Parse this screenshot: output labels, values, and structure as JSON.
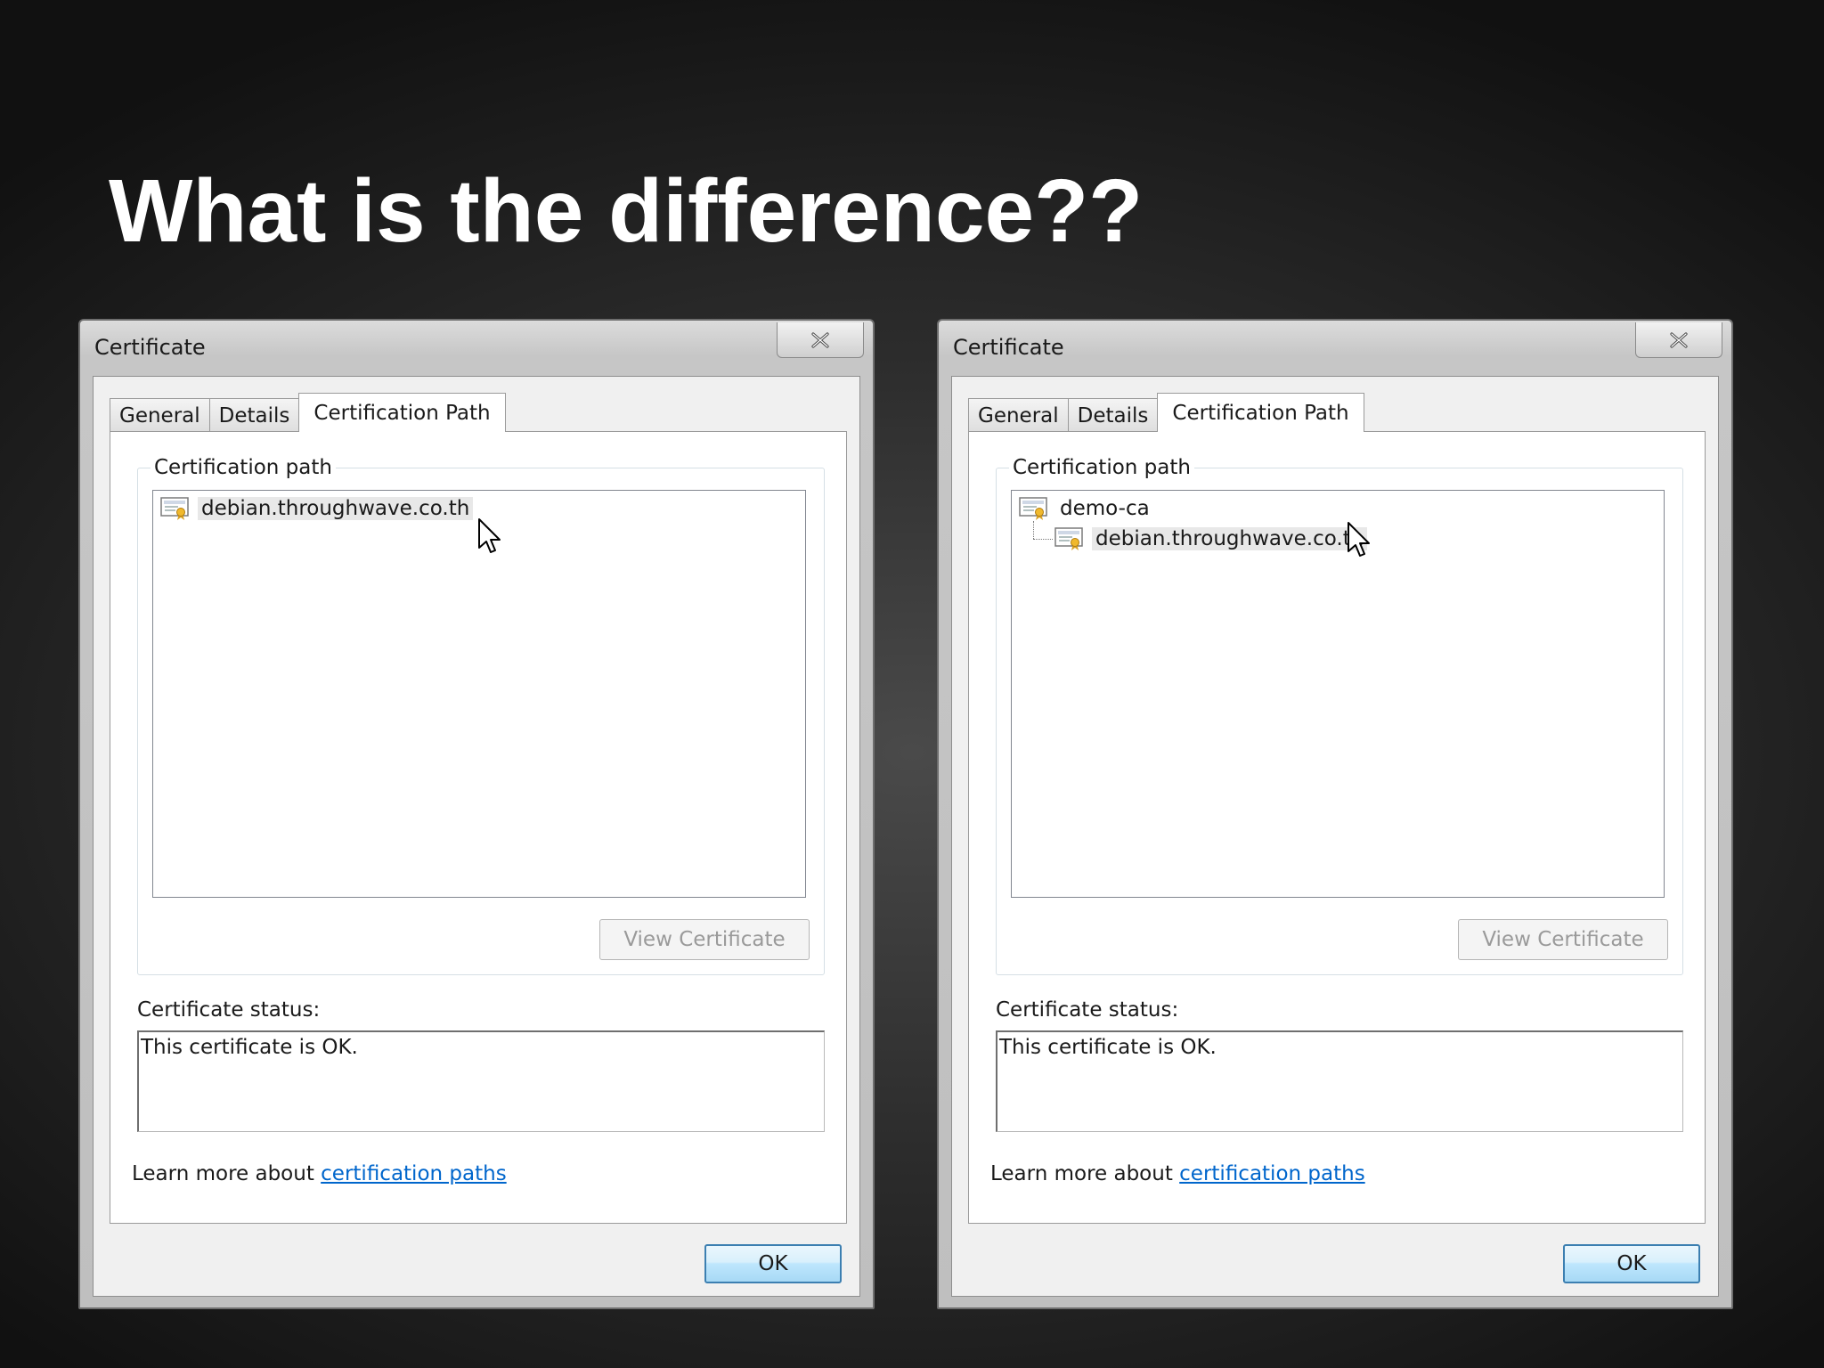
{
  "slide": {
    "title": "What is the difference??"
  },
  "dialogs": [
    {
      "title": "Certificate",
      "tabs": [
        "General",
        "Details",
        "Certification Path"
      ],
      "active_tab": "Certification Path",
      "group_label": "Certification path",
      "tree": [
        {
          "label": "debian.throughwave.co.th",
          "level": 0,
          "selected": true,
          "icon": "certificate-icon"
        }
      ],
      "view_certificate_label": "View Certificate",
      "status_label": "Certificate status:",
      "status_text": "This certificate is OK.",
      "learn_more_prefix": "Learn more about ",
      "learn_more_link": "certification paths",
      "ok_label": "OK"
    },
    {
      "title": "Certificate",
      "tabs": [
        "General",
        "Details",
        "Certification Path"
      ],
      "active_tab": "Certification Path",
      "group_label": "Certification path",
      "tree": [
        {
          "label": "demo-ca",
          "level": 0,
          "selected": false,
          "icon": "certificate-icon"
        },
        {
          "label": "debian.throughwave.co.th",
          "level": 1,
          "selected": true,
          "icon": "certificate-icon"
        }
      ],
      "view_certificate_label": "View Certificate",
      "status_label": "Certificate status:",
      "status_text": "This certificate is OK.",
      "learn_more_prefix": "Learn more about ",
      "learn_more_link": "certification paths",
      "ok_label": "OK"
    }
  ],
  "colors": {
    "link": "#0066cc",
    "ok_border": "#3c7fb1",
    "disabled_text": "#9a9a9a"
  }
}
